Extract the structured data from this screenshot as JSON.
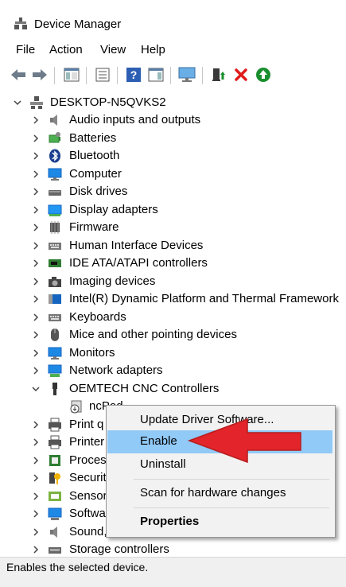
{
  "window": {
    "title": "Device Manager"
  },
  "menu": [
    "File",
    "Action",
    "View",
    "Help"
  ],
  "toolbar": [
    {
      "icon": "back-arrow-icon"
    },
    {
      "icon": "forward-arrow-icon"
    },
    {
      "icon": "show-hide-console-tree-icon"
    },
    {
      "icon": "properties-icon"
    },
    {
      "icon": "help-icon"
    },
    {
      "icon": "action-pane-icon"
    },
    {
      "icon": "monitor-icon"
    },
    {
      "icon": "update-driver-icon"
    },
    {
      "icon": "uninstall-device-icon",
      "color": "#e01b1b"
    },
    {
      "icon": "enable-device-icon",
      "color": "#1a8f2e"
    }
  ],
  "tree": {
    "root": "DESKTOP-N5QVKS2",
    "categories": [
      {
        "label": "Audio inputs and outputs",
        "icon": "speaker-icon"
      },
      {
        "label": "Batteries",
        "icon": "battery-icon"
      },
      {
        "label": "Bluetooth",
        "icon": "bluetooth-icon"
      },
      {
        "label": "Computer",
        "icon": "computer-icon"
      },
      {
        "label": "Disk drives",
        "icon": "disk-drive-icon"
      },
      {
        "label": "Display adapters",
        "icon": "display-adapter-icon"
      },
      {
        "label": "Firmware",
        "icon": "firmware-icon"
      },
      {
        "label": "Human Interface Devices",
        "icon": "hid-icon"
      },
      {
        "label": "IDE ATA/ATAPI controllers",
        "icon": "ide-controller-icon"
      },
      {
        "label": "Imaging devices",
        "icon": "camera-icon"
      },
      {
        "label": "Intel(R) Dynamic Platform and Thermal Framework",
        "icon": "intel-platform-icon"
      },
      {
        "label": "Keyboards",
        "icon": "keyboard-icon"
      },
      {
        "label": "Mice and other pointing devices",
        "icon": "mouse-icon"
      },
      {
        "label": "Monitors",
        "icon": "monitor-icon"
      },
      {
        "label": "Network adapters",
        "icon": "network-adapter-icon"
      },
      {
        "label": "OEMTECH CNC Controllers",
        "icon": "usb-plug-icon",
        "expanded": true
      },
      {
        "label": "ncPod",
        "icon": "disabled-device-icon",
        "child": true
      },
      {
        "label": "Print q",
        "icon": "printer-icon"
      },
      {
        "label": "Printer",
        "icon": "printer-icon"
      },
      {
        "label": "Proces",
        "icon": "processor-icon"
      },
      {
        "label": "Securit",
        "icon": "security-key-icon"
      },
      {
        "label": "Sensor",
        "icon": "sensor-icon"
      },
      {
        "label": "Softwa",
        "icon": "software-device-icon"
      },
      {
        "label": "Sound,",
        "icon": "speaker-icon"
      },
      {
        "label": "Storage controllers",
        "icon": "storage-controller-icon"
      }
    ]
  },
  "context_menu": {
    "items": [
      {
        "label": "Update Driver Software..."
      },
      {
        "label": "Enable",
        "highlighted": true
      },
      {
        "label": "Uninstall"
      },
      {
        "label": "Scan for hardware changes"
      },
      {
        "label": "Properties",
        "bold": true
      }
    ]
  },
  "annotation": {
    "icon": "red-arrow-icon",
    "color": "#e3242b"
  },
  "status": {
    "text": "Enables the selected device."
  },
  "colors": {
    "highlight": "#91c9f7",
    "menu_bg": "#f2f2f2",
    "status_bg": "#f0f0f0"
  }
}
